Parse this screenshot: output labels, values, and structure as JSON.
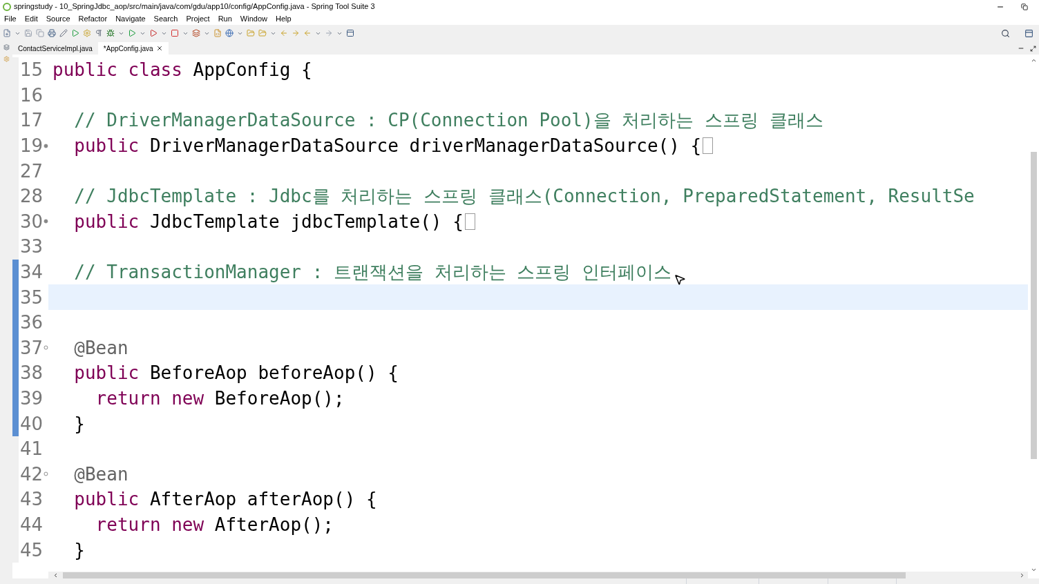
{
  "window": {
    "title": "springstudy - 10_SpringJdbc_aop/src/main/java/com/gdu/app10/config/AppConfig.java - Spring Tool Suite 3"
  },
  "menu": [
    "File",
    "Edit",
    "Source",
    "Refactor",
    "Navigate",
    "Search",
    "Project",
    "Run",
    "Window",
    "Help"
  ],
  "tabs": [
    {
      "label": "ContactServiceImpl.java",
      "selected": false
    },
    {
      "label": "*AppConfig.java",
      "selected": true
    }
  ],
  "editor": {
    "lines": [
      {
        "number": "15",
        "changed": false,
        "tokens": [
          {
            "kind": "keyword",
            "text": "public class"
          },
          {
            "kind": "plain",
            "text": " AppConfig {"
          }
        ]
      },
      {
        "number": "16",
        "changed": false
      },
      {
        "number": "17",
        "changed": false,
        "tokens": [
          {
            "kind": "comment",
            "text": "  // DriverManagerDataSource : CP(Connection Pool)을 처리하는 스프링 클래스"
          }
        ]
      },
      {
        "number": "19",
        "folded": true,
        "changed": false,
        "tokens": [
          {
            "kind": "keyword",
            "text": "  public"
          },
          {
            "kind": "plain",
            "text": " DriverManagerDataSource driverManagerDataSource() {"
          }
        ]
      },
      {
        "number": "27",
        "changed": false
      },
      {
        "number": "28",
        "changed": false,
        "tokens": [
          {
            "kind": "comment",
            "text": "  // JdbcTemplate : Jdbc를 처리하는 스프링 클래스(Connection, PreparedStatement, ResultSe"
          }
        ]
      },
      {
        "number": "30",
        "folded": true,
        "changed": false,
        "tokens": [
          {
            "kind": "keyword",
            "text": "  public"
          },
          {
            "kind": "plain",
            "text": " JdbcTemplate jdbcTemplate() {"
          }
        ]
      },
      {
        "number": "33",
        "changed": false
      },
      {
        "number": "34",
        "changed": true,
        "tokens": [
          {
            "kind": "comment",
            "text": "  // TransactionManager : 트랜잭션을 처리하는 스프링 인터페이스"
          }
        ]
      },
      {
        "number": "35",
        "changed": true,
        "current": true
      },
      {
        "number": "36",
        "changed": true
      },
      {
        "number": "37",
        "folded": false,
        "changed": true,
        "tokens": [
          {
            "kind": "annotation",
            "text": "  @Bean"
          }
        ]
      },
      {
        "number": "38",
        "changed": true,
        "tokens": [
          {
            "kind": "keyword",
            "text": "  public"
          },
          {
            "kind": "plain",
            "text": " BeforeAop beforeAop() {"
          }
        ]
      },
      {
        "number": "39",
        "changed": true,
        "tokens": [
          {
            "kind": "keyword",
            "text": "    return new"
          },
          {
            "kind": "plain",
            "text": " BeforeAop();"
          }
        ]
      },
      {
        "number": "40",
        "changed": true,
        "tokens": [
          {
            "kind": "plain",
            "text": "  }"
          }
        ]
      },
      {
        "number": "41",
        "changed": false
      },
      {
        "number": "42",
        "folded": false,
        "changed": false,
        "tokens": [
          {
            "kind": "annotation",
            "text": "  @Bean"
          }
        ]
      },
      {
        "number": "43",
        "changed": false,
        "tokens": [
          {
            "kind": "keyword",
            "text": "  public"
          },
          {
            "kind": "plain",
            "text": " AfterAop afterAop() {"
          }
        ]
      },
      {
        "number": "44",
        "changed": false,
        "tokens": [
          {
            "kind": "keyword",
            "text": "    return new"
          },
          {
            "kind": "plain",
            "text": " AfterAop();"
          }
        ]
      },
      {
        "number": "45",
        "changed": false,
        "tokens": [
          {
            "kind": "plain",
            "text": "  }"
          }
        ]
      }
    ]
  }
}
